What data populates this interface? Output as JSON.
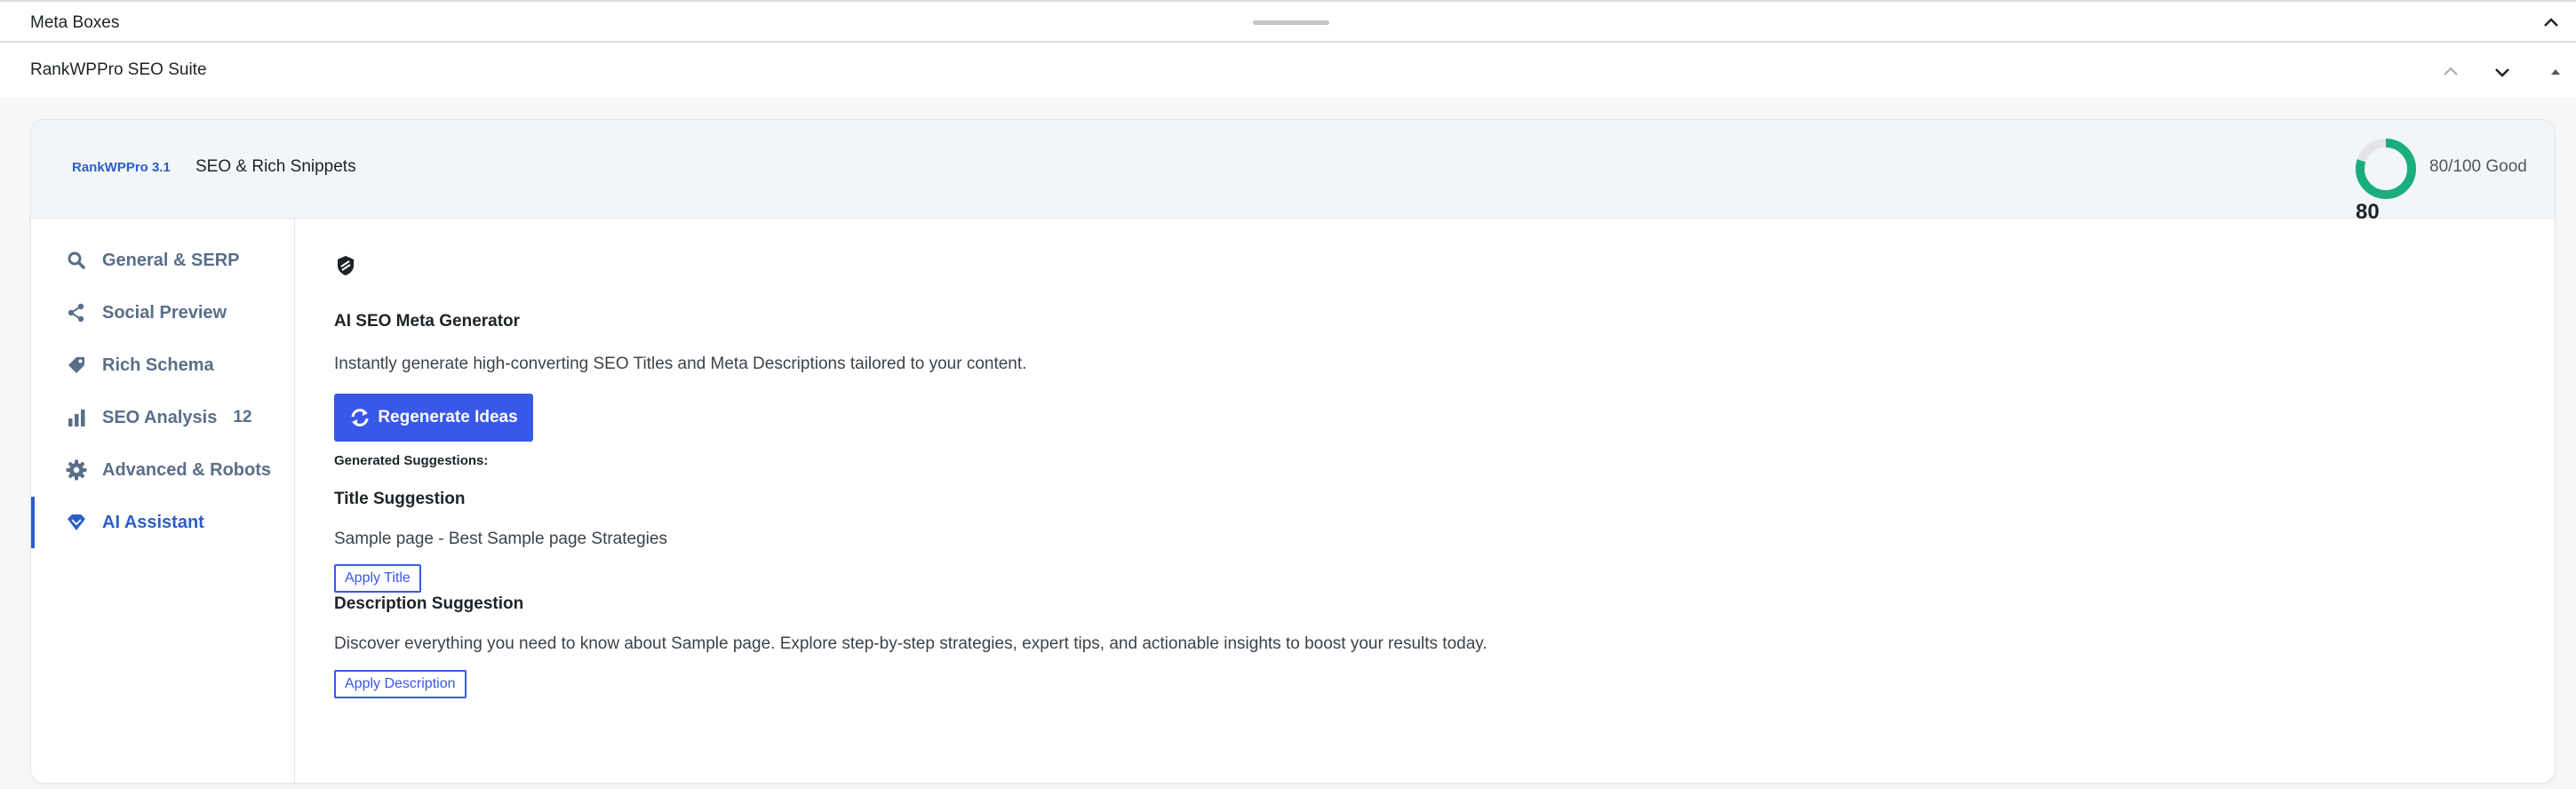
{
  "metabox_bar": {
    "title": "Meta Boxes"
  },
  "postbox": {
    "title": "RankWPPro SEO Suite"
  },
  "panel": {
    "brand": "RankWPPro 3.1",
    "subtitle": "SEO & Rich Snippets",
    "score": {
      "value": 80,
      "max": 100,
      "display": "80",
      "label": "80/100 Good",
      "color": "#1aae7c"
    }
  },
  "sidebar": {
    "items": [
      {
        "label": "General & SERP",
        "icon": "search-icon"
      },
      {
        "label": "Social Preview",
        "icon": "share-icon"
      },
      {
        "label": "Rich Schema",
        "icon": "tag-icon"
      },
      {
        "label": "SEO Analysis",
        "icon": "bar-chart-icon",
        "badge": "12"
      },
      {
        "label": "Advanced & Robots",
        "icon": "gear-icon"
      },
      {
        "label": "AI Assistant",
        "icon": "diamond-icon",
        "active": true
      }
    ]
  },
  "ai": {
    "heading": "AI SEO Meta Generator",
    "description": "Instantly generate high-converting SEO Titles and Meta Descriptions tailored to your content.",
    "regenerate_label": "Regenerate Ideas",
    "generated_label": "Generated Suggestions:",
    "title_heading": "Title Suggestion",
    "title_suggestion": "Sample page - Best Sample page Strategies",
    "apply_title_label": "Apply Title",
    "desc_heading": "Description Suggestion",
    "desc_suggestion": "Discover everything you need to know about Sample page. Explore step-by-step strategies, expert tips, and actionable insights to boost your results today.",
    "apply_desc_label": "Apply Description"
  },
  "colors": {
    "accent": "#3858e9",
    "brand": "#2c5ec6",
    "score": "#1aae7c"
  }
}
